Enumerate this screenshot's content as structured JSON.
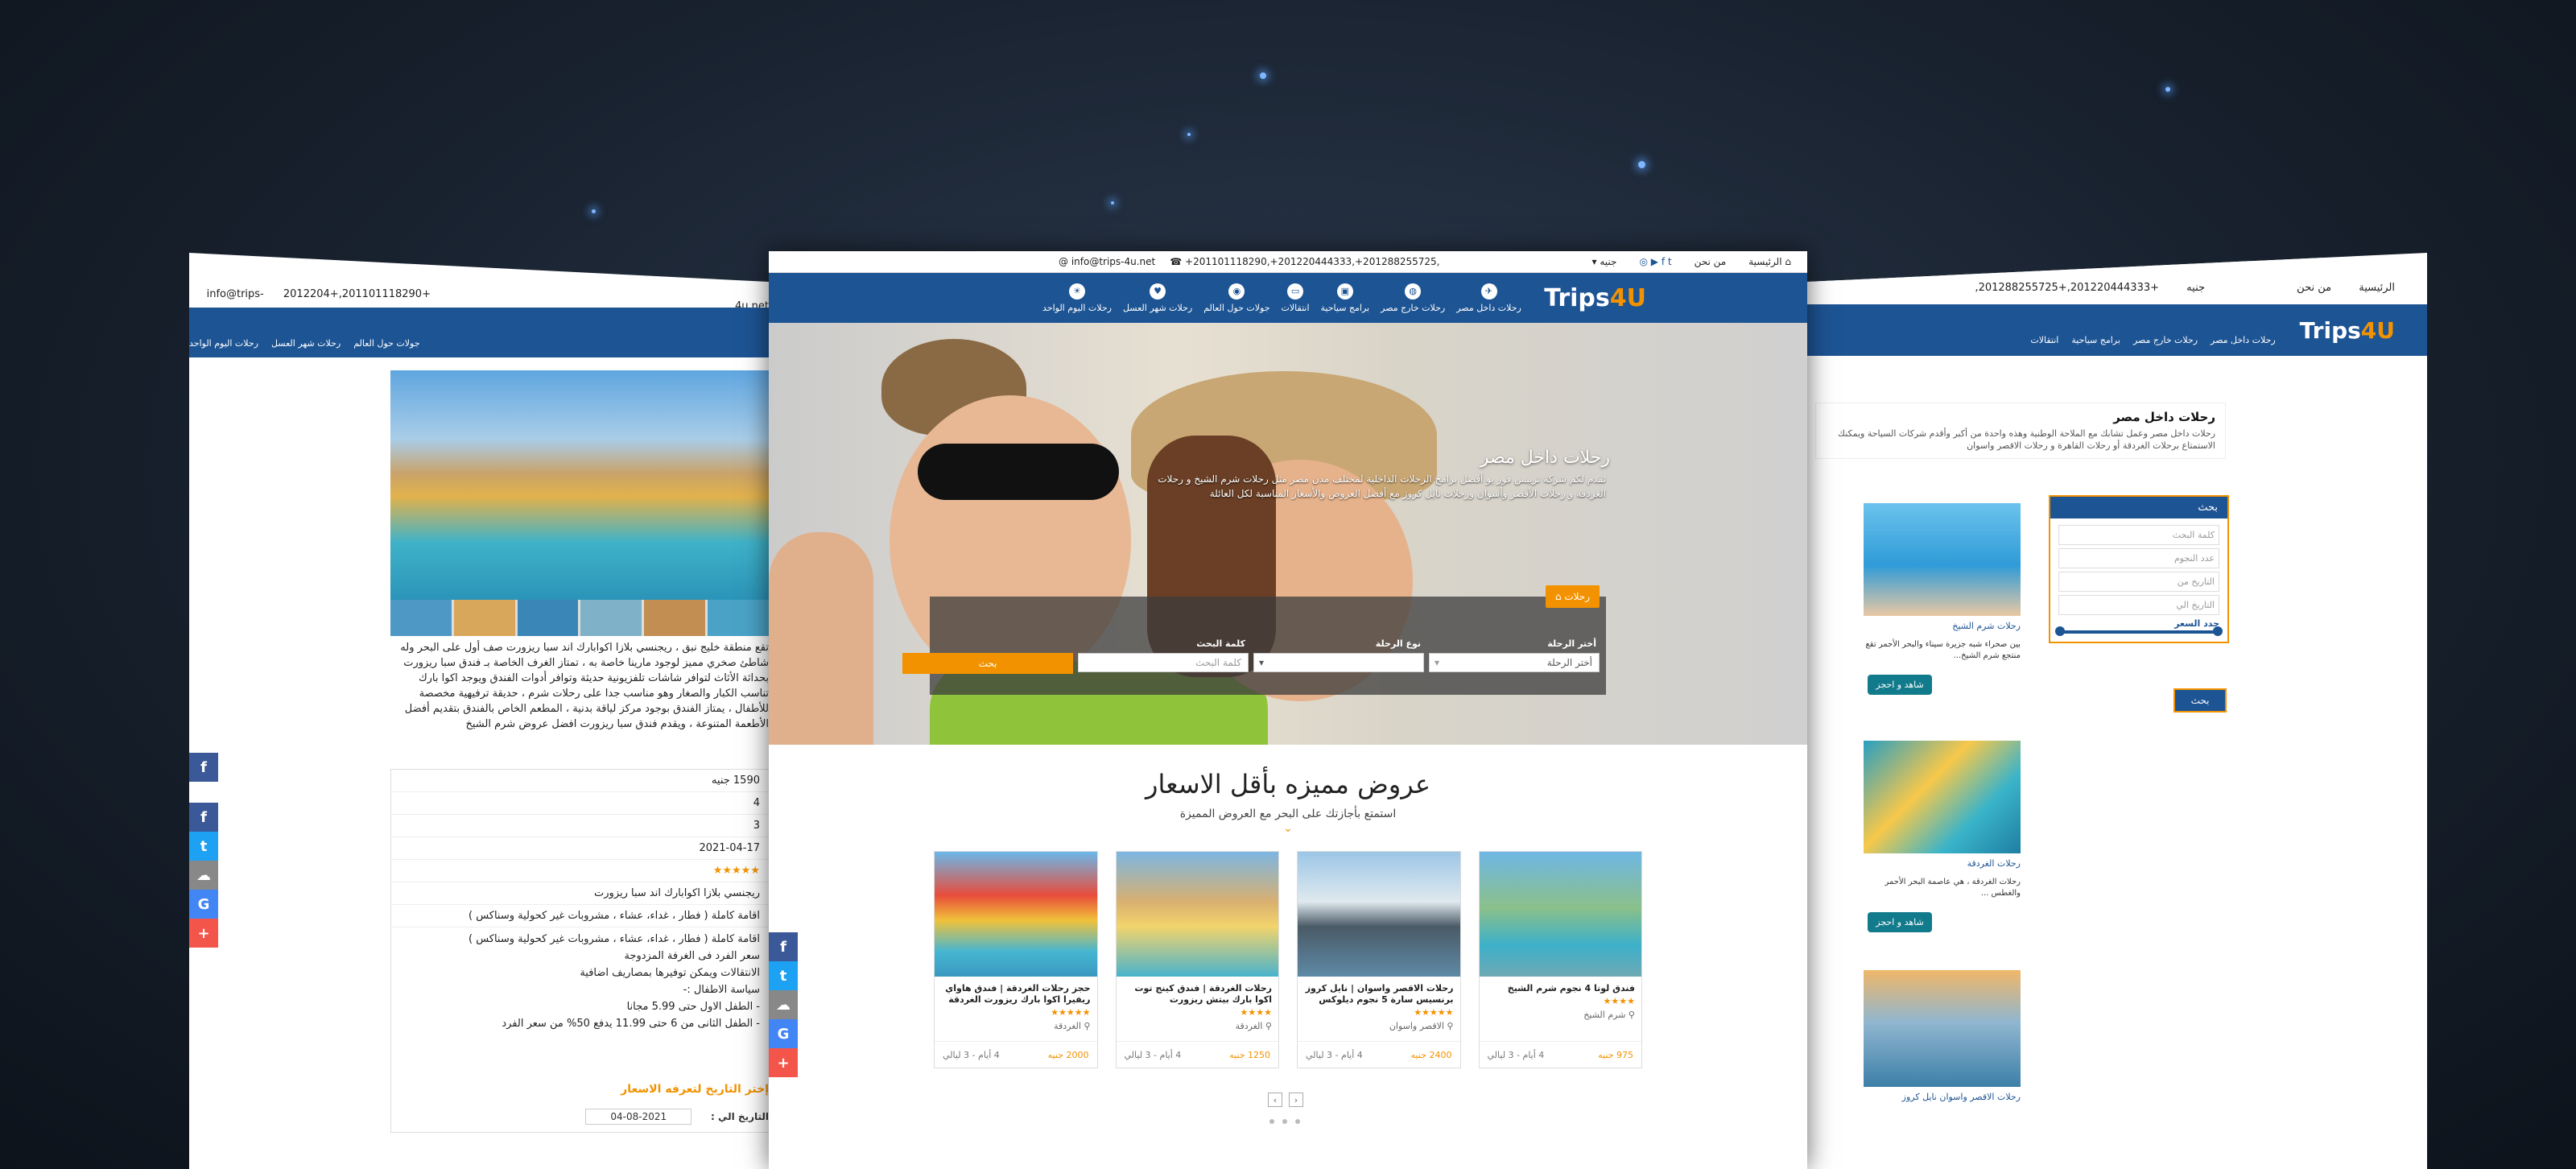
{
  "topbar": {
    "home": "الرئيسية",
    "about": "من نحن",
    "currency": "جنيه",
    "phones": "+201101118290,+201220444333,+201288255725,",
    "email": "info@trips-4u.net"
  },
  "logo": {
    "main": "Trips",
    "accent": "4U"
  },
  "nav": [
    {
      "label": "رحلات داخل مصر",
      "icon": "plane-icon"
    },
    {
      "label": "رحلات خارج مصر",
      "icon": "globe-icon"
    },
    {
      "label": "برامج سياحية",
      "icon": "suitcase-icon"
    },
    {
      "label": "انتقالات",
      "icon": "bus-icon"
    },
    {
      "label": "جولات حول العالم",
      "icon": "world-icon"
    },
    {
      "label": "رحلات شهر العسل",
      "icon": "heart-icon"
    },
    {
      "label": "رحلات اليوم الواحد",
      "icon": "sun-icon"
    }
  ],
  "hero": {
    "title": "رحلات داخل مصر",
    "description": "تقدم لكم شركة تريبس فور يو أفضل برامج الرحلات الداخلية لمختلف مدن مصر مثل رحلات شرم الشيخ و رحلات الغردقة و رحلات الأقصر وأسوان ورحلات نايل كروز مع أفضل العروض والأسعار المناسبة لكل العائلة"
  },
  "search": {
    "tab": "رحلات",
    "field1_label": "أختر الرحلة",
    "field1_value": "أختر الرحلة",
    "field2_label": "نوع الرحلة",
    "field3_label": "كلمة البحث",
    "field3_placeholder": "كلمة البحث",
    "button": "بحث"
  },
  "offers": {
    "title": "عروض مميزه بأقل الاسعار",
    "subtitle": "استمتع بأجازتك على البحر مع العروض المميزة",
    "cards": [
      {
        "title": "فندق لوتا 4 نجوم شرم الشيخ",
        "stars": "★★★★",
        "location": "شرم الشيخ",
        "price": "975 جنيه",
        "duration": "4 أيام - 3 ليالي"
      },
      {
        "title": "رحلات الاقصر واسوان | نايل كروز برنسيس سارة 5 نجوم ديلوكس",
        "stars": "★★★★★",
        "location": "الاقصر واسوان",
        "price": "2400 جنيه",
        "duration": "4 أيام - 3 ليالي"
      },
      {
        "title": "رحلات الغردقة | فندق كينج توت اكوا بارك بيتش ريزورت",
        "stars": "★★★★",
        "location": "الغردقة",
        "price": "1250 جنيه",
        "duration": "4 أيام - 3 ليالي"
      },
      {
        "title": "حجز رحلات الغردقة | فندق هاواي ريفيرا اكوا بارك ريزورت الغردقة",
        "stars": "★★★★★",
        "location": "الغردقة",
        "price": "2000 جنيه",
        "duration": "4 أيام - 3 ليالي"
      }
    ]
  },
  "left_panel": {
    "email": "info@trips-4u.net",
    "phones": "+201101118290,+2012204",
    "nav": [
      "رحلات اليوم الواحد",
      "رحلات شهر العسل",
      "جولات حول العالم"
    ],
    "body": "تقع منطقة خليج نبق ، ريجنسي بلازا اكوابارك اند سبا ريزورت صف أول على البحر وله شاطئ صخري مميز لوجود مارينا خاصة به ، تمتاز الغرف الخاصة بـ فندق سبا ريزورت بحداثة الأثاث لتوافر شاشات تلفزيونية حديثة وتوافر أدوات الفندق ويوجد اكوا بارك تناسب الكبار والصغار وهو مناسب جدا على رحلات شرم ، حديقة ترفيهية مخصصة للأطفال ، يمتاز الفندق بوجود مركز لياقة بدنية ، المطعم الخاص بالفندق بتقديم أفضل الأطعمة المتنوعة ، ويقدم فندق سبا ريزورت افضل عروض شرم الشيخ",
    "price": "1590 جنيه",
    "v1": "4",
    "v2": "3",
    "date": "2021-04-17",
    "rating": "★★★★★",
    "hotel": "ريجنسي بلازا اكوابارك اند سبا ريزورت",
    "meal": "اقامة كاملة ( فطار ، غداء، عشاء ، مشروبات غير كحولية وسناكس )",
    "bullets": [
      "اقامة كاملة ( فطار ، غداء، عشاء ، مشروبات غير كحولية وسناكس )",
      "سعر الفرد فى الغرفة المزدوجة",
      "الانتقالات ويمكن توفيرها بمصاريف اضافية",
      "سياسة الاطفال :-",
      "- الطفل الاول حتى 5.99 مجانا",
      "- الطفل الثانى من 6 حتى 11.99 يدفع 50% من سعر الفرد"
    ],
    "price_note": "إختر التاريخ لتعرفه الاسعار",
    "date_label": "التاريخ الي :",
    "date2": "2021-08-04"
  },
  "right_panel": {
    "phones": "+201220444333,+201288255725,",
    "currency": "جنيه",
    "about": "من نحن",
    "home": "الرئيسية",
    "nav": [
      "رحلات داخل مصر",
      "رحلات خارج مصر",
      "برامج سياحية",
      "انتقالات"
    ],
    "breadcrumb_home": "الرئيسية",
    "breadcrumb_current": "رحلات داخل مصر",
    "heading": "رحلات داخل مصر",
    "intro": "رحلات داخل مصر وعمل تشابك مع الملاحة الوطنية وهذه واحدة من أكبر وأقدم شركات السياحة ويمكنك الاستمتاع برحلات الغردقة أو رحلات القاهرة و رحلات الاقصر واسوان",
    "search_title": "بحث",
    "search_placeholder": "كلمة البحث",
    "nights": "عدد النجوم",
    "date_from": "التاريخ من",
    "date_to": "التاريخ الي",
    "price_label": "حدد السعر",
    "search_button": "بحث",
    "items": [
      {
        "title": "رحلات شرم الشيخ",
        "desc": "بين صحراء شبه جزيرة سيناء والبحر الأحمر تقع منتجع شرم الشيخ...",
        "button": "شاهد و احجز"
      },
      {
        "title": "رحلات الغردقة",
        "desc": "رحلات الغردقة ، هي عاصمة البحر الأحمر والغطس ...",
        "button": "شاهد و احجز"
      },
      {
        "title": "رحلات الاقصر واسوان نايل كروز",
        "desc": "",
        "button": ""
      }
    ]
  },
  "share": [
    "f",
    "t",
    "☁",
    "G",
    "+"
  ]
}
